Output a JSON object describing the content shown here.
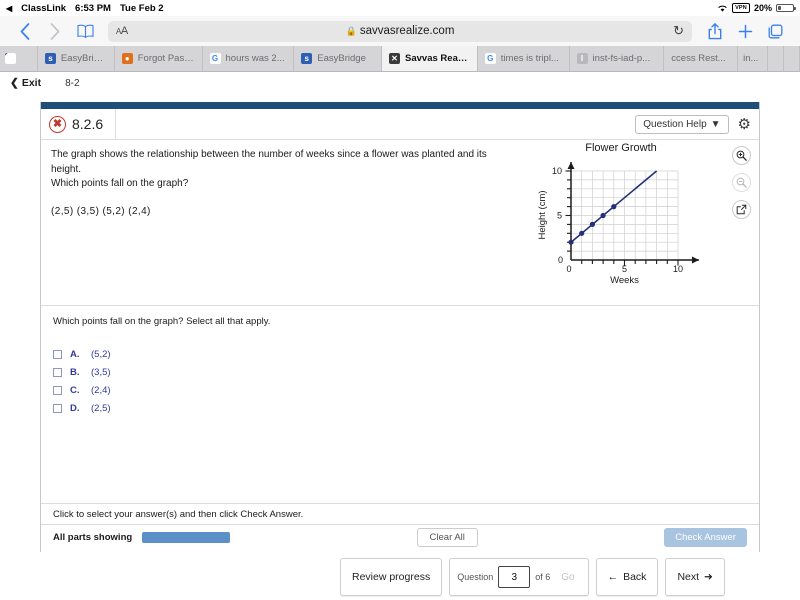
{
  "statusbar": {
    "back_app": "ClassLink",
    "back_caret": "◀",
    "time": "6:53 PM",
    "date": "Tue Feb 2",
    "wifi_icon": "wifi-icon",
    "vpn_label": "VPN",
    "battery_percent": "20%"
  },
  "browser": {
    "back_icon": "chevron-left-icon",
    "forward_icon": "chevron-right-icon",
    "bookmarks_icon": "book-icon",
    "text_size_label": "A",
    "text_size_small": "A",
    "lock_icon": "🔒",
    "url": "savvasrealize.com",
    "reload_icon": "↻",
    "share_icon": "share-icon",
    "new_tab_icon": "+",
    "tabs_icon": "tabs-icon",
    "tabs": [
      {
        "label": "",
        "favicon": "stripe-icon",
        "active": false
      },
      {
        "label": "EasyBridge",
        "favicon": "easybridge-icon",
        "active": false
      },
      {
        "label": "Forgot Pass...",
        "favicon": "orange-circle-icon",
        "active": false
      },
      {
        "label": "hours was 2...",
        "favicon": "google-icon",
        "active": false
      },
      {
        "label": "EasyBridge",
        "favicon": "easybridge-icon",
        "active": false
      },
      {
        "label": "Savvas Realize",
        "favicon": "savvas-icon",
        "active": true
      },
      {
        "label": "times is tripl...",
        "favicon": "google-icon",
        "active": false
      },
      {
        "label": "inst-fs-iad-p...",
        "favicon": "instructure-icon",
        "active": false
      },
      {
        "label": "ccess Rest...",
        "favicon": "",
        "active": false
      },
      {
        "label": "in...",
        "favicon": "",
        "active": false
      }
    ]
  },
  "exitbar": {
    "back_icon": "❮",
    "exit_label": "Exit",
    "lesson_code": "8-2"
  },
  "question_header": {
    "status_icon": "✖",
    "question_number": "8.2.6",
    "help_label": "Question Help",
    "help_caret": "▼",
    "settings_icon": "⚙"
  },
  "question": {
    "stem_line1": "The graph shows the relationship between the number of weeks since a flower was planted and its height.",
    "stem_line2": "Which points fall on the graph?",
    "points_list": "(2,5)  (3,5)  (5,2)  (2,4)",
    "prompt": "Which points fall on the graph? Select all that apply.",
    "choices": [
      {
        "letter": "A.",
        "value": "(5,2)",
        "checked": false
      },
      {
        "letter": "B.",
        "value": "(3,5)",
        "checked": false
      },
      {
        "letter": "C.",
        "value": "(2,4)",
        "checked": false
      },
      {
        "letter": "D.",
        "value": "(2,5)",
        "checked": false
      }
    ]
  },
  "chart_tools": {
    "zoom_in_icon": "zoom-in-icon",
    "zoom_out_icon": "zoom-out-icon",
    "open_new_icon": "open-external-icon"
  },
  "hint": {
    "text": "Click to select your answer(s) and then click Check Answer."
  },
  "status": {
    "all_parts_label": "All parts showing",
    "clear_all_label": "Clear All",
    "check_answer_label": "Check Answer",
    "progress_color": "#5b8fc7"
  },
  "footer": {
    "review_label": "Review progress",
    "question_word": "Question",
    "question_value": "3",
    "of_label": "of 6",
    "go_label": "Go",
    "back_label": "Back",
    "back_icon": "←",
    "next_label": "Next",
    "next_icon": "➜"
  },
  "chart_data": {
    "type": "scatter",
    "title": "Flower Growth",
    "xlabel": "Weeks",
    "ylabel": "Height (cm)",
    "xlim": [
      0,
      11
    ],
    "ylim": [
      0,
      11
    ],
    "xticks": [
      0,
      5,
      10
    ],
    "yticks": [
      0,
      5,
      10
    ],
    "xtick_labels": [
      "0",
      "5",
      "10"
    ],
    "ytick_labels": [
      "0",
      "5",
      "10"
    ],
    "grid": true,
    "minor_tick_step": 1,
    "point_color": "#25307a",
    "line_color": "#25307a",
    "x": [
      0,
      1,
      2,
      3,
      4
    ],
    "y": [
      2,
      3,
      4,
      5,
      6
    ],
    "line_equation": "y = x + 2",
    "line_from": [
      0,
      2
    ],
    "line_to": [
      8,
      10
    ],
    "legend": null
  }
}
